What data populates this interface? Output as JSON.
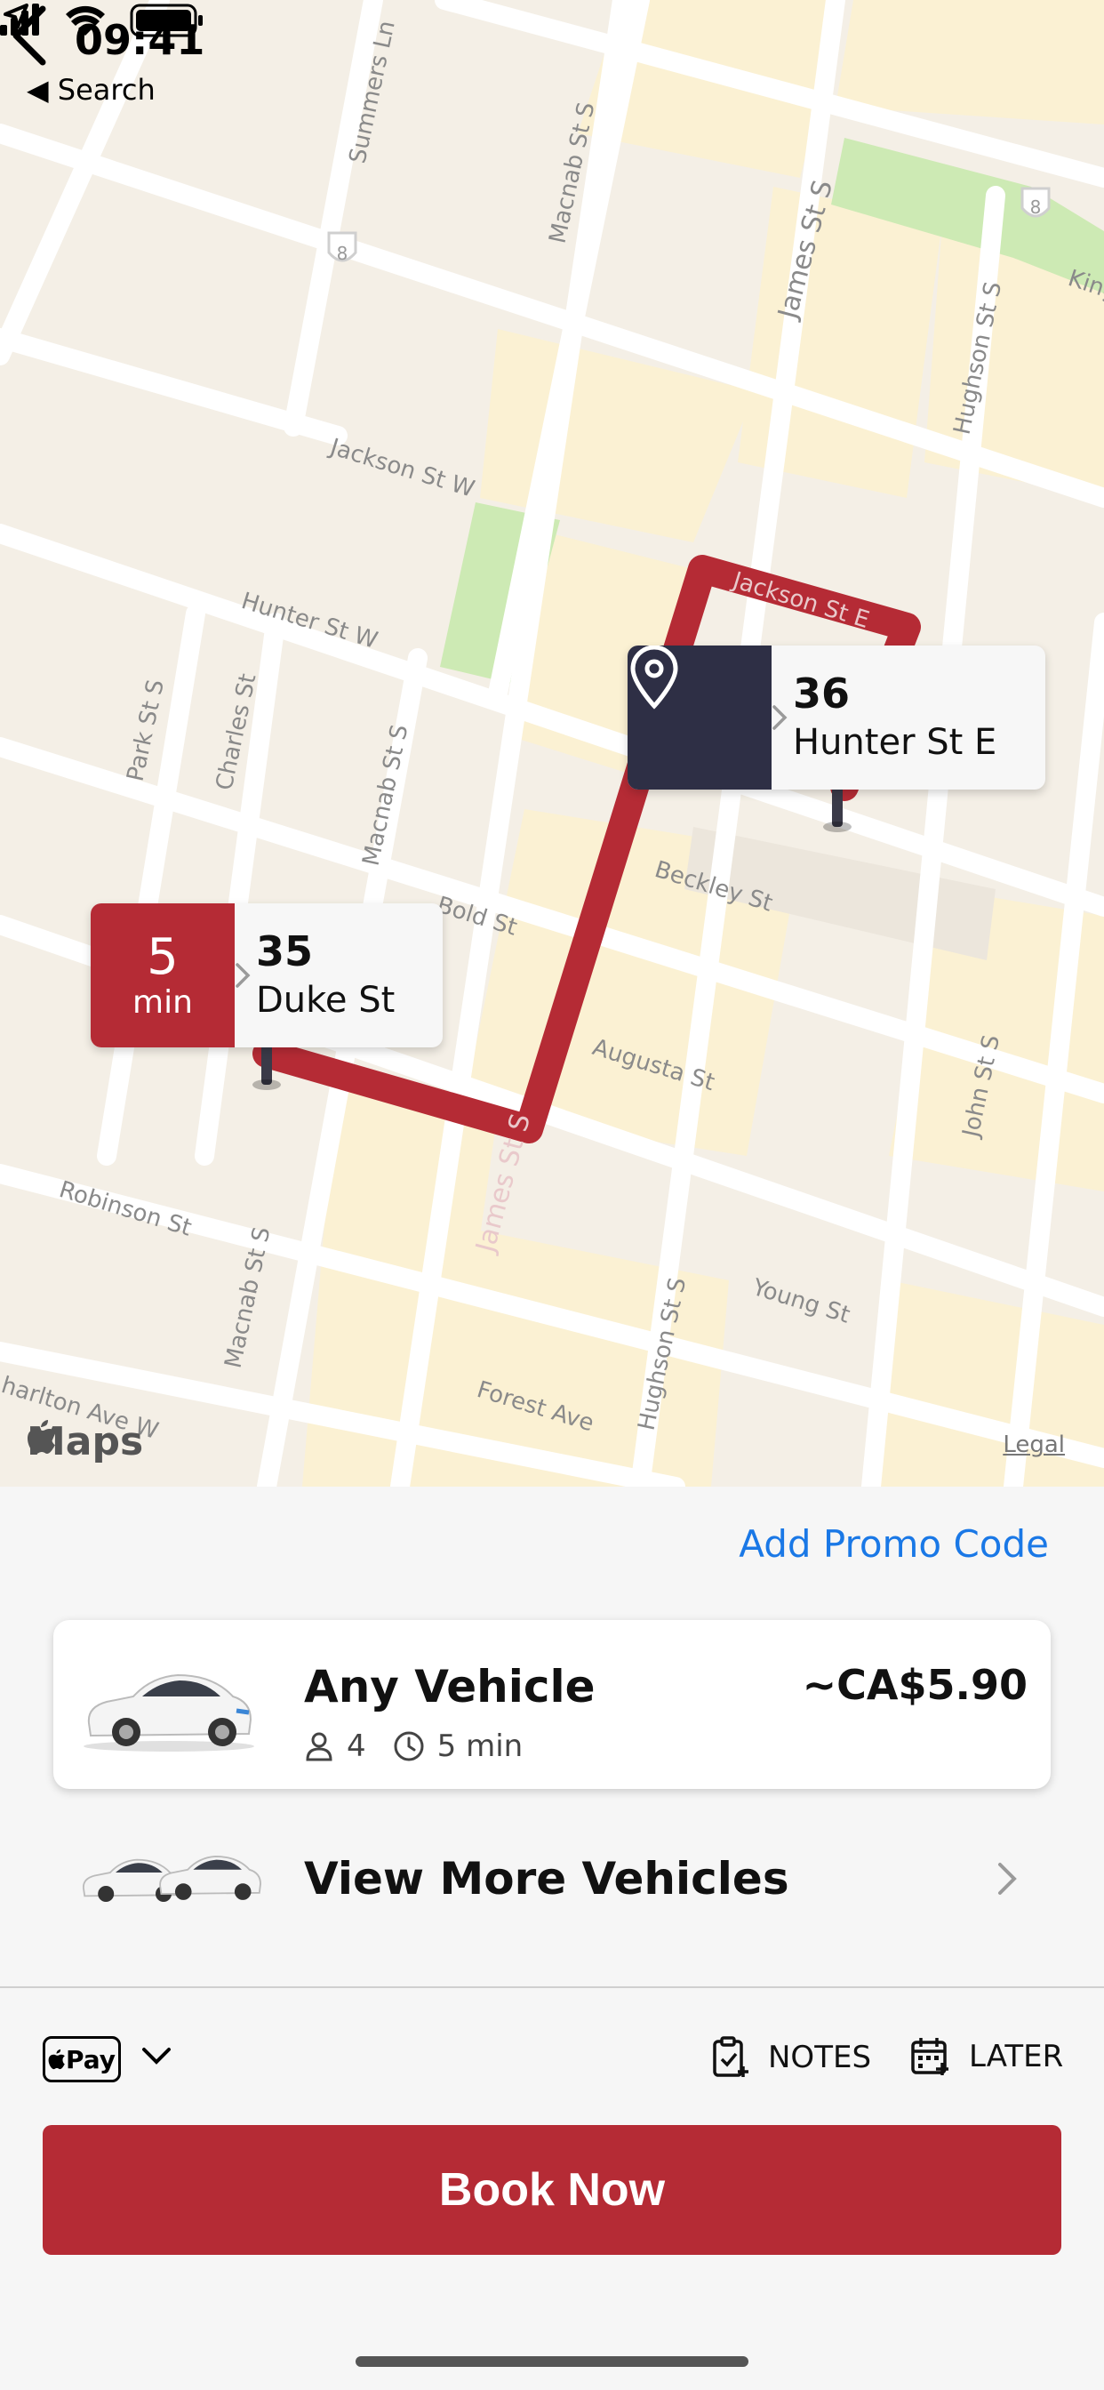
{
  "status": {
    "time": "09:41",
    "back_app": "◀ Search"
  },
  "map": {
    "streets": {
      "summers": "Summers Ln",
      "macnab_n": "Macnab St S",
      "james_n": "James St S",
      "hughson_n": "Hughson St S",
      "king": "King",
      "jackson_w": "Jackson St W",
      "jackson_e": "Jackson St E",
      "hunter_w": "Hunter St W",
      "park": "Park St S",
      "charles": "Charles St",
      "macnab_m": "Macnab St S",
      "bold": "Bold St",
      "beckley": "Beckley St",
      "augusta": "Augusta St",
      "john": "John St S",
      "robinson": "Robinson St",
      "macnab_s": "Macnab St S",
      "james_s": "James St S",
      "hughson_s": "Hughson St S",
      "young": "Young St",
      "forest": "Forest Ave",
      "charlton": "harlton Ave W"
    },
    "highway_number": "8",
    "destination": {
      "number": "36",
      "street": "Hunter St E",
      "icon": "location-pin-icon"
    },
    "pickup": {
      "eta_value": "5",
      "eta_unit": "min",
      "number": "35",
      "street": "Duke St"
    },
    "maps_label": "Maps",
    "legal_label": "Legal",
    "colors": {
      "route": "#b52b35",
      "destination_bg": "#2e2f45",
      "park": "#cdeab4"
    }
  },
  "sheet": {
    "promo_label": "Add Promo Code",
    "vehicle": {
      "name": "Any Vehicle",
      "price": "~CA$5.90",
      "seats": "4",
      "eta": "5 min"
    },
    "more_label": "View More Vehicles",
    "payment": {
      "method_label": "Pay"
    },
    "notes_label": "NOTES",
    "later_label": "LATER",
    "book_label": "Book Now"
  },
  "colors": {
    "accent": "#b52b35",
    "link": "#1a78e6"
  }
}
